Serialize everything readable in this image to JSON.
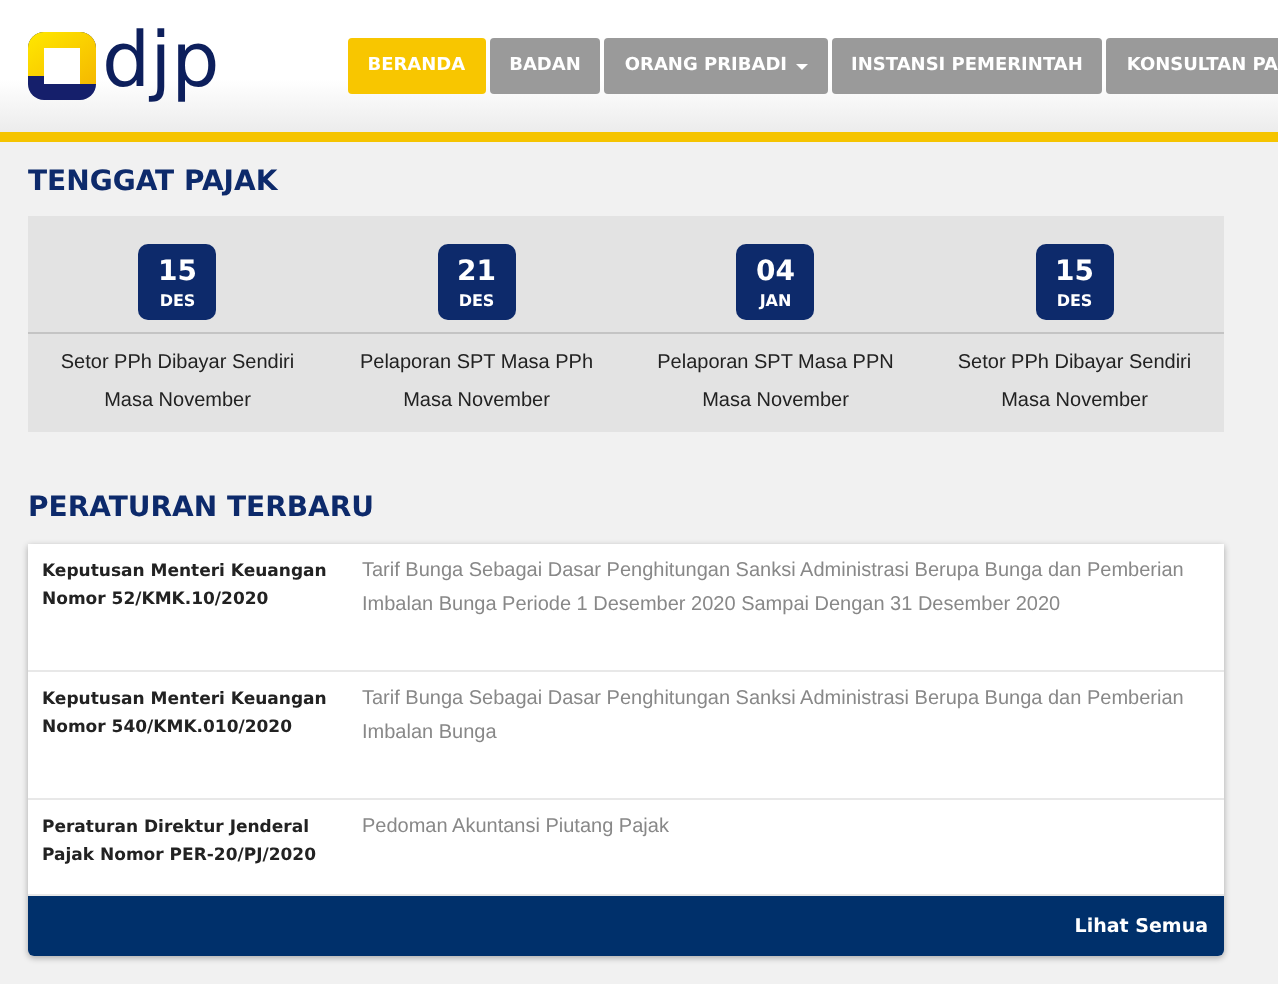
{
  "header": {
    "logo_text": "djp",
    "nav": [
      {
        "label": "BERANDA",
        "selected": true,
        "dropdown": false
      },
      {
        "label": "BADAN",
        "selected": false,
        "dropdown": false
      },
      {
        "label": "ORANG PRIBADI",
        "selected": false,
        "dropdown": true
      },
      {
        "label": "INSTANSI PEMERINTAH",
        "selected": false,
        "dropdown": false
      },
      {
        "label": "KONSULTAN PA",
        "selected": false,
        "dropdown": false
      }
    ]
  },
  "deadlines": {
    "title": "TENGGAT PAJAK",
    "items": [
      {
        "day": "15",
        "month": "DES",
        "text": "Setor PPh Dibayar Sendiri Masa November"
      },
      {
        "day": "21",
        "month": "DES",
        "text": "Pelaporan SPT Masa PPh Masa November"
      },
      {
        "day": "04",
        "month": "JAN",
        "text": "Pelaporan SPT Masa PPN Masa November"
      },
      {
        "day": "15",
        "month": "DES",
        "text": "Setor PPh Dibayar Sendiri Masa November"
      }
    ]
  },
  "regulations": {
    "title": "PERATURAN TERBARU",
    "rows": [
      {
        "name": "Keputusan Menteri Keuangan Nomor 52/KMK.10/2020",
        "description": "Tarif Bunga Sebagai Dasar Penghitungan Sanksi Administrasi Berupa Bunga dan Pemberian Imbalan Bunga Periode 1 Desember 2020 Sampai Dengan 31 Desember 2020"
      },
      {
        "name": "Keputusan Menteri Keuangan Nomor 540/KMK.010/2020",
        "description": "Tarif Bunga Sebagai Dasar Penghitungan Sanksi Administrasi Berupa Bunga dan Pemberian Imbalan Bunga"
      },
      {
        "name": "Peraturan Direktur Jenderal Pajak Nomor PER-20/PJ/2020",
        "description": "Pedoman Akuntansi Piutang Pajak"
      }
    ],
    "footer_link": "Lihat Semua"
  }
}
